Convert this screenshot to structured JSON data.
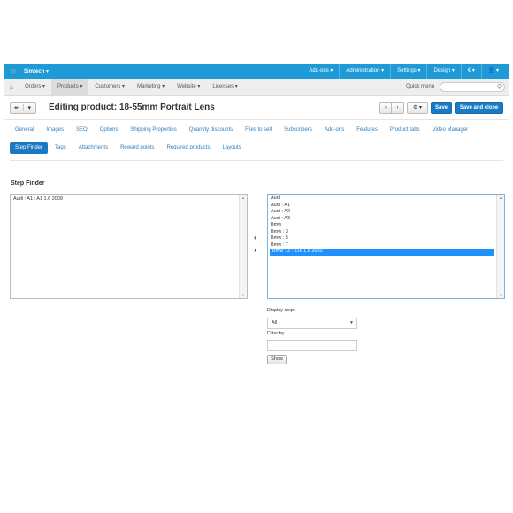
{
  "topbar": {
    "store": "Simtech ▾",
    "menus": [
      "Add-ons ▾",
      "Administration ▾",
      "Settings ▾",
      "Design ▾",
      "€ ▾",
      "👤 ▾"
    ],
    "logo_icon": "cart-icon"
  },
  "navbar": {
    "items": [
      "Orders ▾",
      "Products ▾",
      "Customers ▾",
      "Marketing ▾",
      "Website ▾",
      "Licenses ▾"
    ],
    "active_index": 1,
    "quick_menu": "Quick menu",
    "search_placeholder": ""
  },
  "title": {
    "text": "Editing product: 18-55mm Portrait Lens",
    "save": "Save",
    "save_close": "Save and close",
    "gear": "⚙ ▾"
  },
  "tabs": [
    "General",
    "Images",
    "SEO",
    "Options",
    "Shipping Properties",
    "Quantity discounts",
    "Files to sell",
    "Subscribers",
    "Add-ons",
    "Features",
    "Product tabs",
    "Video Manager",
    "Step Finder",
    "Tags",
    "Attachments",
    "Reward points",
    "Required products",
    "Layouts"
  ],
  "active_tab": "Step Finder",
  "section_title": "Step Finder",
  "left_list": [
    "Audi : A1 : A1 1.6 2009"
  ],
  "right_list": [
    "Audi",
    "Audi : A1",
    "Audi : A2",
    "Audi : A3",
    "Bmw",
    "Bmw : 3",
    "Bmw : 5",
    "Bmw : 7",
    "Bmw : 3 : 316 1.6 2010"
  ],
  "right_selected": "Bmw : 3 : 316 1.6 2010",
  "display_step_label": "Display step:",
  "display_step_value": "All",
  "filter_label": "Filter by",
  "show_button": "Show",
  "colors": {
    "topbar": "#1e9ad6",
    "primary": "#1a7bc4",
    "selected": "#1e90ff"
  }
}
